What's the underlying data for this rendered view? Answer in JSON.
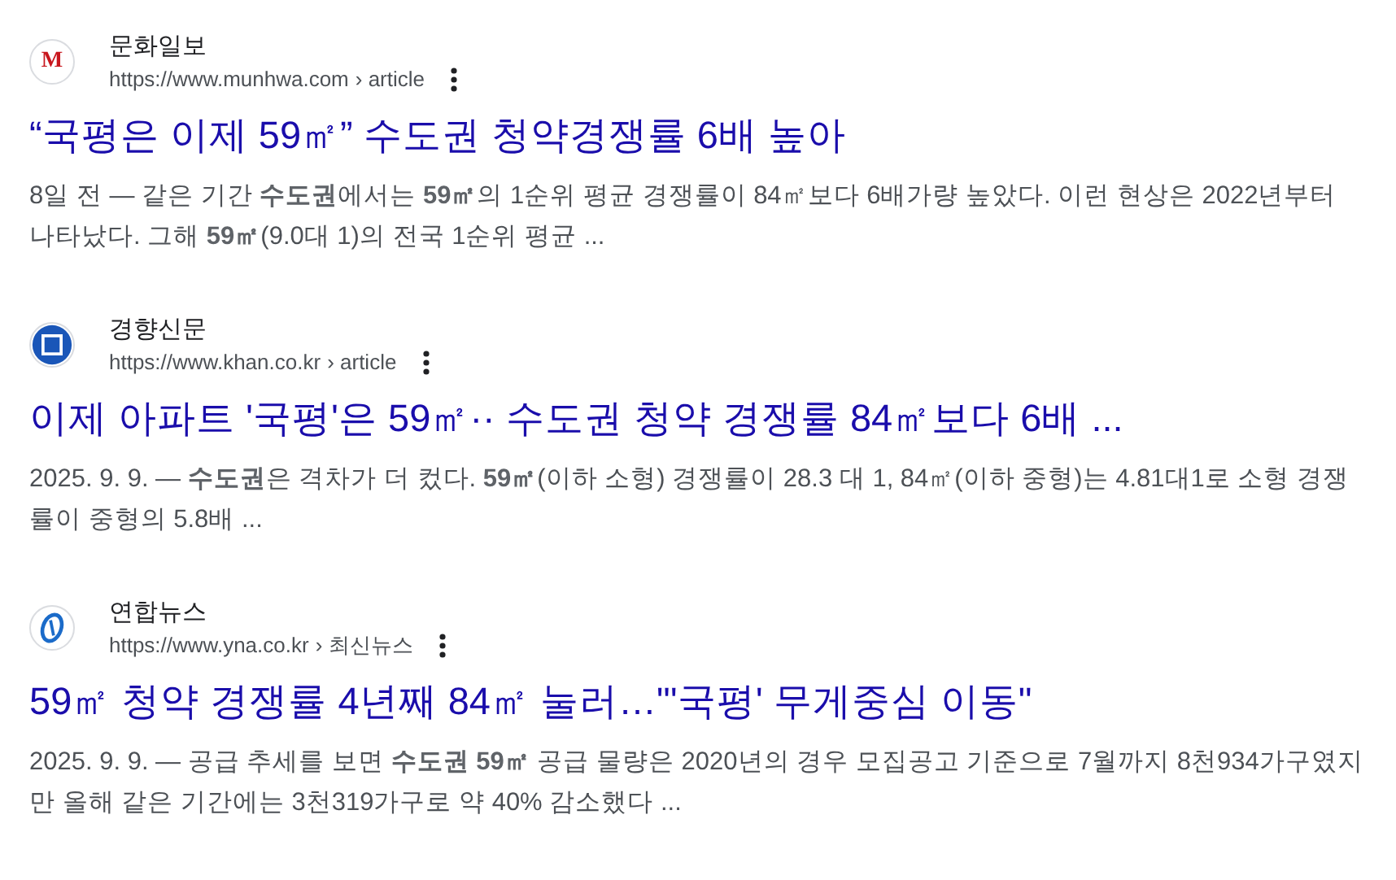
{
  "results": [
    {
      "kind": "serif-letter",
      "logo_text": "M",
      "site": "문화일보",
      "url": "https://www.munhwa.com",
      "path": "› article",
      "title": "“국평은 이제 59㎡” 수도권 청약경쟁률 6배 높아",
      "snippet": "8일 전 — 같은 기간 **수도권**에서는 **59㎡**의 1순위 평균 경쟁률이 84㎡보다 6배가량 높았다. 이런 현상은 2022년부터 나타났다. 그해 **59㎡**(9.0대 1)의 전국 1순위 평균 ..."
    },
    {
      "kind": "square",
      "site": "경향신문",
      "url": "https://www.khan.co.kr",
      "path": "› article",
      "title": "이제 아파트 '국평'은 59㎡·· 수도권 청약 경쟁률 84㎡보다 6배 ...",
      "snippet": "2025. 9. 9. — **수도권**은 격차가 더 컸다. **59㎡**(이하 소형) 경쟁률이 28.3 대 1, 84㎡(이하 중형)는 4.81대1로 소형 경쟁률이 중형의 5.8배 ..."
    },
    {
      "kind": "swirl",
      "site": "연합뉴스",
      "url": "https://www.yna.co.kr",
      "path": "› 최신뉴스",
      "title": "59㎡ 청약 경쟁률 4년째 84㎡ 눌러…\"'국평' 무게중심 이동\"",
      "snippet": "2025. 9. 9. — 공급 추세를 보면 **수도권 59㎡** 공급 물량은 2020년의 경우 모집공고 기준으로 7월까지 8천934가구였지만 올해 같은 기간에는 3천319가구로 약 40% 감소했다 ..."
    }
  ]
}
